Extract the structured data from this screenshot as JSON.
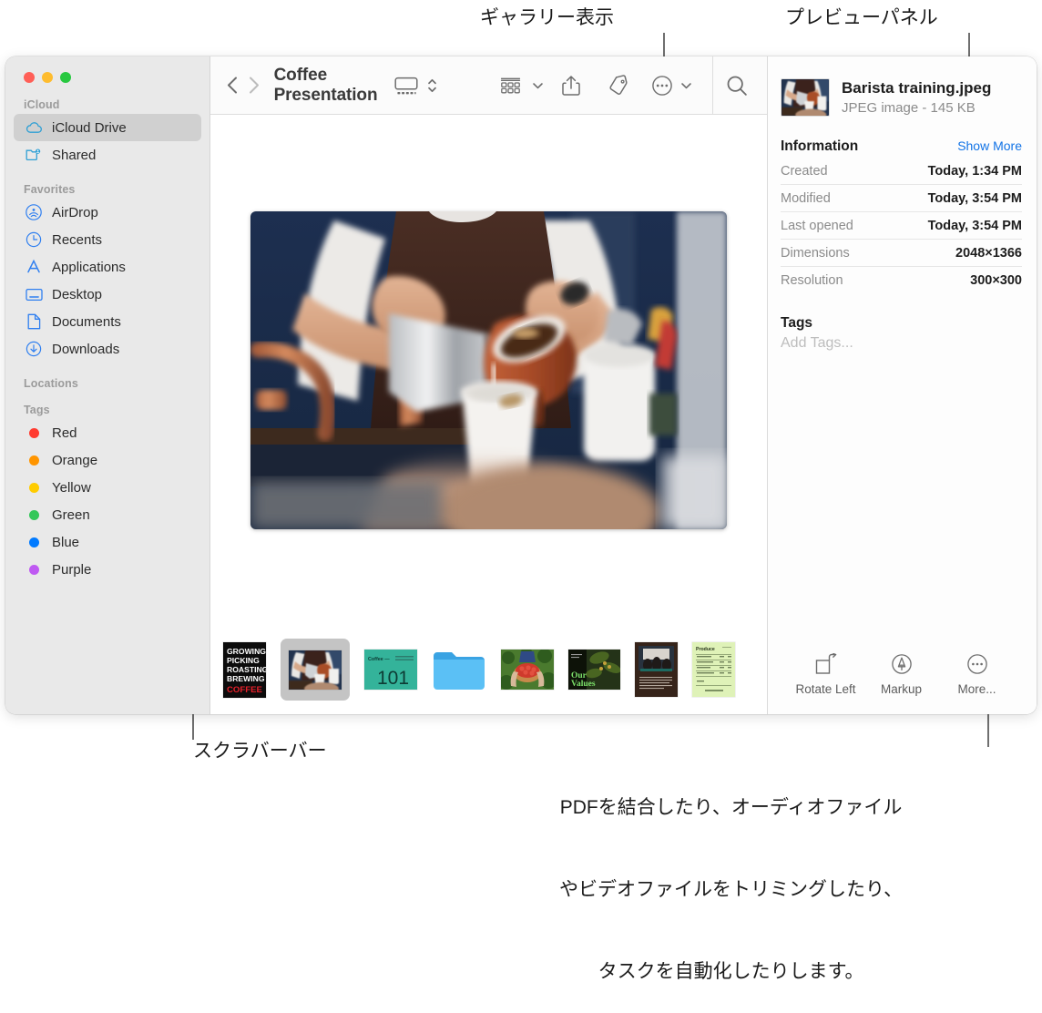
{
  "annotations": {
    "gallery_view": "ギャラリー表示",
    "preview_panel": "プレビューパネル",
    "scrubber_bar": "スクラバーバー",
    "more_description_line1": "PDFを結合したり、オーディオファイル",
    "more_description_line2": "やビデオファイルをトリミングしたり、",
    "more_description_line3": "タスクを自動化したりします。"
  },
  "window": {
    "traffic_lights": [
      "close",
      "minimize",
      "zoom"
    ]
  },
  "sidebar": {
    "sections": [
      {
        "header": "iCloud",
        "items": [
          {
            "label": "iCloud Drive",
            "icon": "cloud-icon",
            "selected": true
          },
          {
            "label": "Shared",
            "icon": "shared-folder-icon",
            "selected": false
          }
        ]
      },
      {
        "header": "Favorites",
        "items": [
          {
            "label": "AirDrop",
            "icon": "airdrop-icon",
            "selected": false
          },
          {
            "label": "Recents",
            "icon": "clock-icon",
            "selected": false
          },
          {
            "label": "Applications",
            "icon": "applications-icon",
            "selected": false
          },
          {
            "label": "Desktop",
            "icon": "desktop-icon",
            "selected": false
          },
          {
            "label": "Documents",
            "icon": "document-icon",
            "selected": false
          },
          {
            "label": "Downloads",
            "icon": "downloads-icon",
            "selected": false
          }
        ]
      },
      {
        "header": "Locations",
        "items": []
      },
      {
        "header": "Tags",
        "items": [
          {
            "label": "Red",
            "icon": "tag-dot-icon",
            "color": "#ff3b30"
          },
          {
            "label": "Orange",
            "icon": "tag-dot-icon",
            "color": "#ff9500"
          },
          {
            "label": "Yellow",
            "icon": "tag-dot-icon",
            "color": "#ffcc00"
          },
          {
            "label": "Green",
            "icon": "tag-dot-icon",
            "color": "#34c759"
          },
          {
            "label": "Blue",
            "icon": "tag-dot-icon",
            "color": "#007aff"
          },
          {
            "label": "Purple",
            "icon": "tag-dot-icon",
            "color": "#bf5af2"
          }
        ]
      }
    ]
  },
  "toolbar": {
    "back_icon": "chevron-left-icon",
    "forward_icon": "chevron-right-icon",
    "title": "Coffee Presentation",
    "view_icon": "gallery-view-icon",
    "view_stepper_icon": "chevron-updown-icon",
    "group_icon": "group-by-icon",
    "group_chevron_icon": "chevron-down-icon",
    "share_icon": "share-icon",
    "tag_icon": "tag-icon",
    "more_icon": "ellipsis-circle-icon",
    "more_chevron_icon": "chevron-down-icon",
    "search_icon": "search-icon"
  },
  "scrubber": {
    "items": [
      {
        "name": "Growing Picking Roasting Brewing Coffee poster",
        "type": "poster",
        "selected": false,
        "lines": [
          "GROWING",
          "PICKING",
          "ROASTING",
          "BREWING"
        ],
        "accent_line": "COFFEE"
      },
      {
        "name": "Barista training.jpeg",
        "type": "photo",
        "selected": true
      },
      {
        "name": "Coffee 101 slide",
        "type": "slide",
        "selected": false,
        "big_text": "101",
        "small_text": "Coffee —"
      },
      {
        "name": "Folder",
        "type": "folder",
        "selected": false
      },
      {
        "name": "Coffee cherries photo",
        "type": "photo",
        "selected": false
      },
      {
        "name": "Our Values slide",
        "type": "slide",
        "selected": false,
        "title_line1": "Our",
        "title_line2": "Values"
      },
      {
        "name": "Meeting document",
        "type": "document",
        "selected": false
      },
      {
        "name": "Produce invoice",
        "type": "spreadsheet",
        "selected": false,
        "heading": "Produce"
      }
    ]
  },
  "preview_panel": {
    "file_name": "Barista training.jpeg",
    "file_meta": "JPEG image - 145 KB",
    "information": {
      "title": "Information",
      "show_more": "Show More",
      "rows": [
        {
          "key": "Created",
          "value": "Today, 1:34 PM"
        },
        {
          "key": "Modified",
          "value": "Today, 3:54 PM"
        },
        {
          "key": "Last opened",
          "value": "Today, 3:54 PM"
        },
        {
          "key": "Dimensions",
          "value": "2048×1366"
        },
        {
          "key": "Resolution",
          "value": "300×300"
        }
      ]
    },
    "tags": {
      "title": "Tags",
      "placeholder": "Add Tags..."
    },
    "actions": [
      {
        "label": "Rotate Left",
        "icon": "rotate-left-icon"
      },
      {
        "label": "Markup",
        "icon": "markup-icon"
      },
      {
        "label": "More...",
        "icon": "ellipsis-circle-icon"
      }
    ]
  },
  "colors": {
    "accent_blue": "#1273e6",
    "sidebar_bg": "#e9e9e9",
    "selection": "#d0d0d0",
    "icon_blue": "#2e9fd4"
  }
}
